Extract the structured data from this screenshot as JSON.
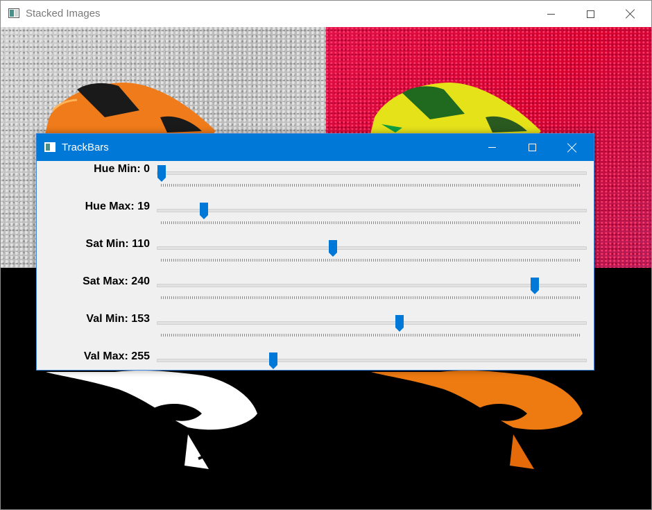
{
  "main_window": {
    "title": "Stacked Images"
  },
  "trackbars_window": {
    "title": "TrackBars",
    "sliders": [
      {
        "label": "Hue Min: 0",
        "value": 0,
        "max": 179
      },
      {
        "label": "Hue Max: 19",
        "value": 19,
        "max": 179
      },
      {
        "label": "Sat Min: 110",
        "value": 110,
        "max": 255
      },
      {
        "label": "Sat Max: 240",
        "value": 240,
        "max": 255
      },
      {
        "label": "Val Min: 153",
        "value": 153,
        "max": 255
      },
      {
        "label": "Val Max: 255",
        "value": 255,
        "max": 255
      }
    ]
  },
  "colors": {
    "accent": "#0078d7",
    "thumb": "#0078d7"
  },
  "icons": {
    "app": "opencv-window-icon",
    "minimize": "minimize-icon",
    "maximize": "maximize-icon",
    "close": "close-icon"
  }
}
